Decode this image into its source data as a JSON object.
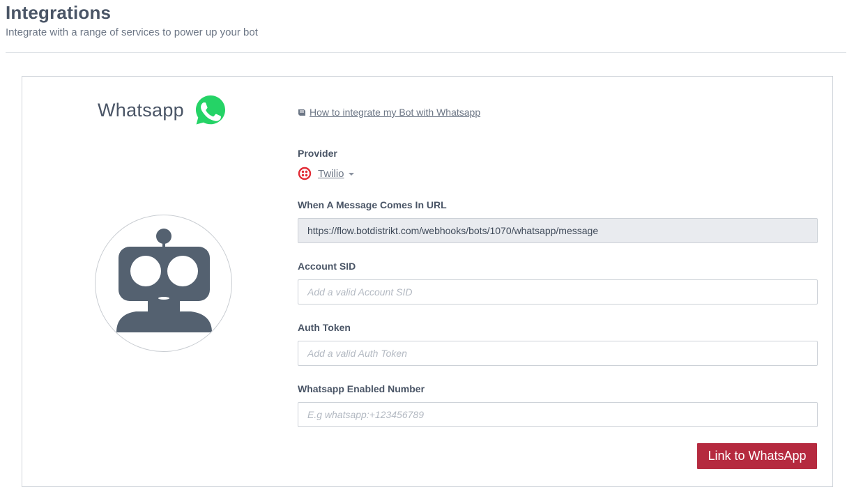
{
  "header": {
    "title": "Integrations",
    "subtitle": "Integrate with a range of services to power up your bot"
  },
  "integration": {
    "name": "Whatsapp",
    "icon": "whatsapp-icon",
    "brand_color": "#25d366",
    "guide_link": "How to integrate my Bot with Whatsapp",
    "guide_icon": "book-icon"
  },
  "provider": {
    "label": "Provider",
    "selected": "Twilio",
    "icon": "twilio-icon",
    "icon_color": "#e22c36"
  },
  "fields": {
    "message_url": {
      "label": "When A Message Comes In URL",
      "value": "https://flow.botdistrikt.com/webhooks/bots/1070/whatsapp/message"
    },
    "account_sid": {
      "label": "Account SID",
      "value": "",
      "placeholder": "Add a valid Account SID"
    },
    "auth_token": {
      "label": "Auth Token",
      "value": "",
      "placeholder": "Add a valid Auth Token"
    },
    "whatsapp_number": {
      "label": "Whatsapp Enabled Number",
      "value": "",
      "placeholder": "E.g whatsapp:+123456789"
    }
  },
  "actions": {
    "link_label": "Link to WhatsApp",
    "button_color": "#b52a3f"
  },
  "avatar": {
    "icon": "robot-avatar-icon",
    "color": "#546170"
  }
}
